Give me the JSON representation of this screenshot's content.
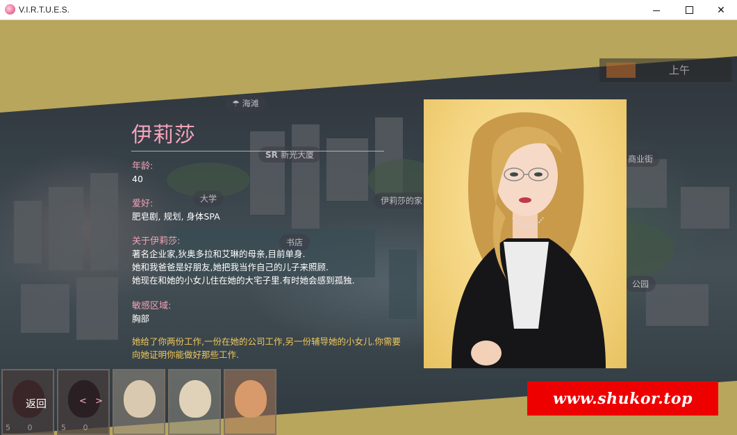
{
  "window": {
    "title": "V.I.R.T.U.E.S.",
    "minimize_icon": "minimize-icon",
    "maximize_icon": "maximize-icon",
    "close_glyph": "✕"
  },
  "map": {
    "labels": {
      "beach": "海滩",
      "building": "新光大厦",
      "university": "大学",
      "house": "伊莉莎的家",
      "bookstore": "书店",
      "commercial": "商业街",
      "park": "公园"
    },
    "time_of_day": "上午"
  },
  "character": {
    "name": "伊莉莎",
    "age_label": "年龄:",
    "age": "40",
    "hobby_label": "爱好:",
    "hobbies": "肥皂剧, 规划, 身体SPA",
    "about_label": "关于伊莉莎:",
    "about_lines": [
      "著名企业家,狄奥多拉和艾琳的母亲,目前单身.",
      "她和我爸爸是好朋友,她把我当作自己的儿子来照顾.",
      "她现在和她的小女儿住在她的大宅子里.有时她会感到孤独."
    ],
    "sensitive_label": "敏感区域:",
    "sensitive_area": "胸部",
    "note": "她给了你两份工作,一份在她的公司工作,另一份辅导她的小女儿.你需要向她证明你能做好那些工作."
  },
  "thumbnails": [
    {
      "stats_left": "5",
      "stats_right": "0"
    },
    {
      "stats_left": "5",
      "stats_right": "0"
    },
    {
      "stats_left": "",
      "stats_right": ""
    },
    {
      "stats_left": "",
      "stats_right": ""
    },
    {
      "stats_left": "",
      "stats_right": ""
    }
  ],
  "controls": {
    "back_label": "返回",
    "nav_label": "< >"
  },
  "watermark": {
    "text": "www.shukor.top"
  },
  "colors": {
    "frame": "#b8a65c",
    "name": "#f4a3bb",
    "label": "#f2a2b6",
    "note": "#f0c95a",
    "watermark_bg": "#ee0000"
  }
}
